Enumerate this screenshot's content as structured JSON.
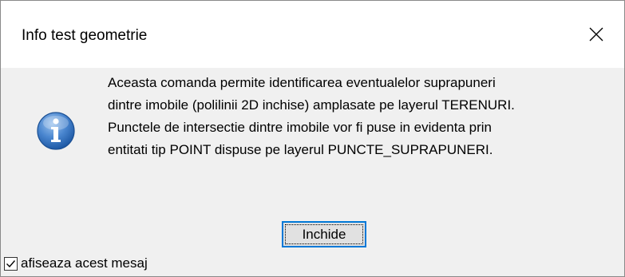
{
  "window": {
    "title": "Info test geometrie",
    "close_icon": "close-icon"
  },
  "icon": {
    "name": "information-icon",
    "color": "#2f6fb8"
  },
  "message": {
    "lines": [
      "Aceasta comanda permite identificarea eventualelor suprapuneri",
      "dintre imobile (polilinii 2D inchise) amplasate pe layerul TERENURI.",
      "Punctele de intersectie dintre imobile vor fi puse in evidenta prin",
      "entitati tip POINT dispuse pe layerul PUNCTE_SUPRAPUNERI."
    ]
  },
  "buttons": {
    "close_label": "Inchide"
  },
  "checkbox": {
    "label": "afiseaza acest mesaj",
    "checked": true
  },
  "colors": {
    "focus_border": "#0078d7",
    "dialog_background": "#f0f0f0",
    "titlebar_background": "#ffffff"
  }
}
